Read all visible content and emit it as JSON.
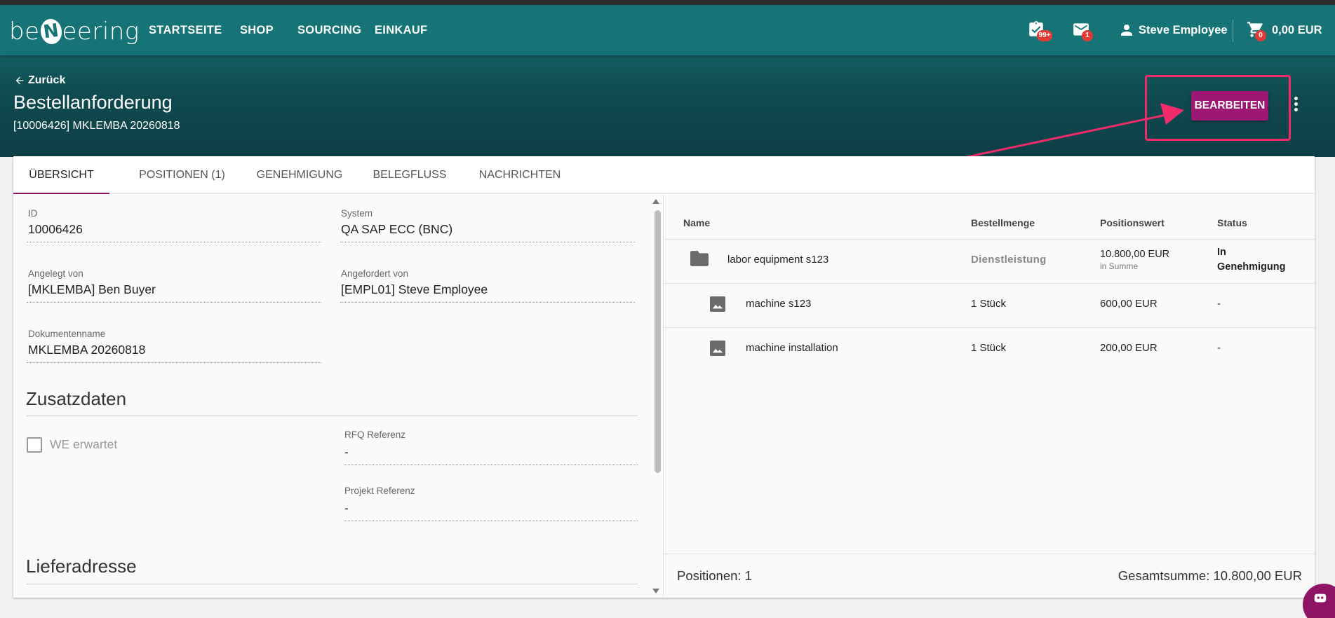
{
  "app": {
    "logo_prefix": "be",
    "logo_letter": "N",
    "logo_suffix": "eering",
    "accent_color": "#167476",
    "brand_button_color": "#9c1873"
  },
  "nav": {
    "items": [
      "STARTSEITE",
      "SHOP",
      "SOURCING",
      "EINKAUF"
    ],
    "tasks_badge": "99+",
    "mail_badge": "1",
    "user_name": "Steve Employee",
    "cart_badge": "0",
    "cart_total": "0,00 EUR"
  },
  "page": {
    "back_label": "Zurück",
    "title": "Bestellanforderung",
    "subtitle": "[10006426] MKLEMBA 20260818",
    "edit_label": "BEARBEITEN"
  },
  "tabs": [
    {
      "label": "ÜBERSICHT",
      "active": true
    },
    {
      "label": "POSITIONEN (1)",
      "active": false
    },
    {
      "label": "GENEHMIGUNG",
      "active": false
    },
    {
      "label": "BELEGFLUSS",
      "active": false
    },
    {
      "label": "NACHRICHTEN",
      "active": false
    }
  ],
  "details": {
    "id_label": "ID",
    "id_value": "10006426",
    "system_label": "System",
    "system_value": "QA SAP ECC (BNC)",
    "created_by_label": "Angelegt von",
    "created_by_value": "[MKLEMBA] Ben Buyer",
    "requested_by_label": "Angefordert von",
    "requested_by_value": "[EMPL01] Steve Employee",
    "docname_label": "Dokumentenname",
    "docname_value": "MKLEMBA 20260818",
    "extra_section": "Zusatzdaten",
    "gr_expected_label": "WE erwartet",
    "rfq_label": "RFQ Referenz",
    "rfq_value": "-",
    "project_label": "Projekt Referenz",
    "project_value": "-",
    "delivery_section": "Lieferadresse"
  },
  "positions": {
    "headers": [
      "Name",
      "Bestellmenge",
      "Positionswert",
      "Status"
    ],
    "rows": [
      {
        "icon": "folder-icon",
        "name": "labor equipment s123",
        "quantity": "Dienstleistung",
        "value": "10.800,00 EUR",
        "value_note": "in Summe",
        "status_line1": "In",
        "status_line2": "Genehmigung"
      },
      {
        "icon": "image-icon",
        "name": "machine s123",
        "quantity": "1 Stück",
        "value": "600,00 EUR",
        "status": "-"
      },
      {
        "icon": "image-icon",
        "name": "machine installation",
        "quantity": "1 Stück",
        "value": "200,00 EUR",
        "status": "-"
      }
    ],
    "footer_count": "Positionen: 1",
    "footer_total": "Gesamtsumme: 10.800,00 EUR"
  }
}
